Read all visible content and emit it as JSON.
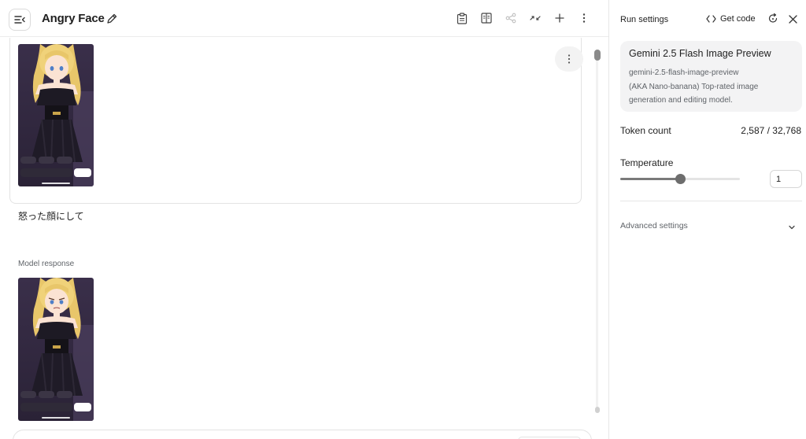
{
  "header": {
    "title": "Angry Face",
    "icons": [
      "menu-collapse-icon",
      "edit-pencil-icon",
      "clipboard-icon",
      "compare-icon",
      "share-icon",
      "compress-icon",
      "add-icon",
      "more-vert-icon"
    ]
  },
  "chat": {
    "prompt_text": "怒った顔にして",
    "model_response_label": "Model response",
    "images": [
      {
        "type": "user-upload",
        "description_icon": "anime-character-screenshot"
      },
      {
        "type": "model-output",
        "description_icon": "anime-character-screenshot"
      }
    ]
  },
  "run_settings": {
    "title": "Run settings",
    "get_code_label": "Get code",
    "model": {
      "name": "Gemini 2.5 Flash Image Preview",
      "id": "gemini-2.5-flash-image-preview",
      "description": "(AKA Nano-banana) Top-rated image generation and editing model."
    },
    "token_count_label": "Token count",
    "token_count_value": "2,587 / 32,768",
    "temperature_label": "Temperature",
    "temperature_value": "1",
    "temperature_fraction": 0.5,
    "advanced_settings_label": "Advanced settings"
  },
  "colors": {
    "accent_gray": "#6d6d6d",
    "card_bg": "#f3f3f4",
    "border": "#e3e3e3"
  }
}
